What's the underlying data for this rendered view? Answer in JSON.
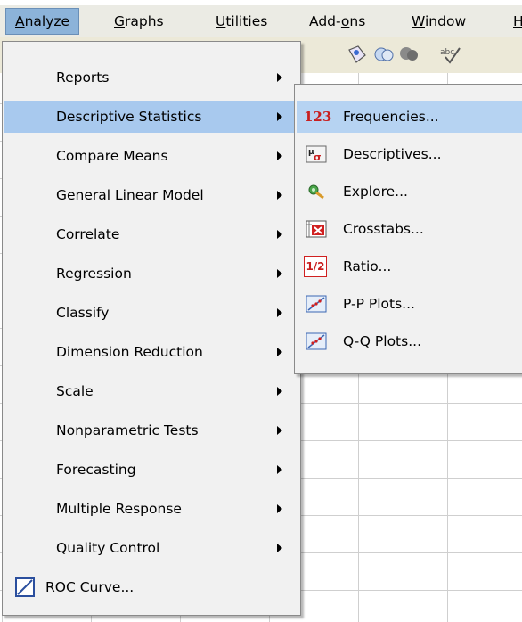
{
  "menubar": {
    "items": [
      {
        "label": "Analyze",
        "access": "A"
      },
      {
        "label": "Graphs",
        "access": "G"
      },
      {
        "label": "Utilities",
        "access": "U"
      },
      {
        "label": "Add-ons",
        "access": "o"
      },
      {
        "label": "Window",
        "access": "W"
      },
      {
        "label": "H",
        "access": "H"
      }
    ]
  },
  "analyze_menu": {
    "items": [
      {
        "label": "Reports",
        "has_submenu": true
      },
      {
        "label": "Descriptive Statistics",
        "has_submenu": true,
        "highlighted": true
      },
      {
        "label": "Compare Means",
        "has_submenu": true
      },
      {
        "label": "General Linear Model",
        "has_submenu": true
      },
      {
        "label": "Correlate",
        "has_submenu": true
      },
      {
        "label": "Regression",
        "has_submenu": true
      },
      {
        "label": "Classify",
        "has_submenu": true
      },
      {
        "label": "Dimension Reduction",
        "has_submenu": true
      },
      {
        "label": "Scale",
        "has_submenu": true
      },
      {
        "label": "Nonparametric Tests",
        "has_submenu": true
      },
      {
        "label": "Forecasting",
        "has_submenu": true
      },
      {
        "label": "Multiple Response",
        "has_submenu": true
      },
      {
        "label": "Quality Control",
        "has_submenu": true
      },
      {
        "label": "ROC Curve...",
        "has_submenu": false,
        "icon": "roc-curve-icon"
      }
    ]
  },
  "descriptive_submenu": {
    "items": [
      {
        "label": "Frequencies...",
        "icon": "frequencies-123-icon",
        "highlighted": true
      },
      {
        "label": "Descriptives...",
        "icon": "descriptives-icon"
      },
      {
        "label": "Explore...",
        "icon": "explore-icon"
      },
      {
        "label": "Crosstabs...",
        "icon": "crosstabs-icon"
      },
      {
        "label": "Ratio...",
        "icon": "ratio-icon"
      },
      {
        "label": "P-P Plots...",
        "icon": "pp-plots-icon"
      },
      {
        "label": "Q-Q Plots...",
        "icon": "qq-plots-icon"
      }
    ],
    "icon_text": {
      "frequencies": "123",
      "ratio": "1/2"
    }
  },
  "colors": {
    "highlight": "#a8c9ee",
    "menubar_active": "#8cb3d9",
    "menu_bg": "#f1f1f1"
  }
}
